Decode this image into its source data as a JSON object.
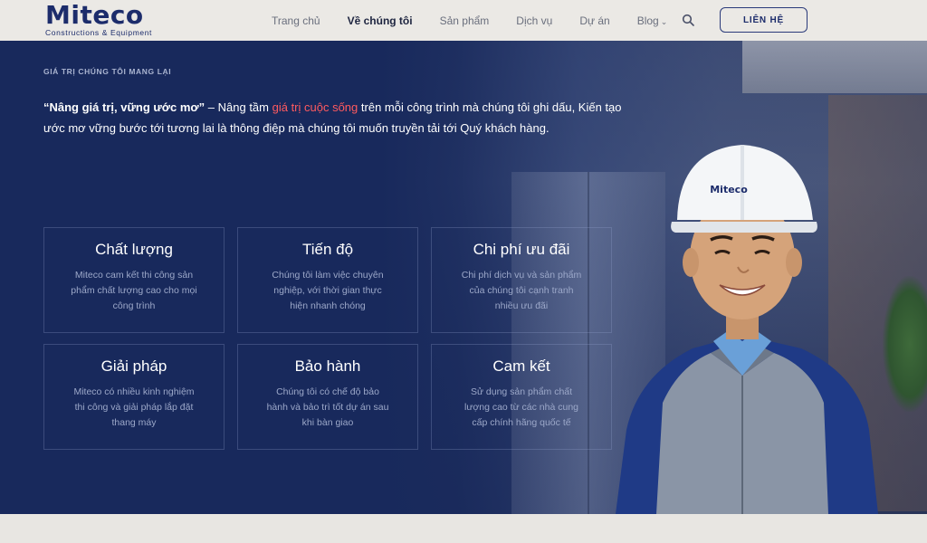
{
  "header": {
    "logo_main": "Miteco",
    "logo_sub": "Constructions & Equipment",
    "nav": [
      {
        "label": "Trang chủ",
        "active": false
      },
      {
        "label": "Về chúng tôi",
        "active": true
      },
      {
        "label": "Sản phẩm",
        "active": false
      },
      {
        "label": "Dịch vụ",
        "active": false
      },
      {
        "label": "Dự án",
        "active": false
      },
      {
        "label": "Blog",
        "active": false
      }
    ],
    "contact_label": "LIÊN HỆ",
    "search_icon": "search-icon"
  },
  "hero": {
    "section_label": "GIÁ TRỊ CHÚNG TÔI MANG LẠI",
    "intro_bold": "“Nâng giá trị, vững ước mơ”",
    "intro_part1": " – Nâng tầm ",
    "intro_highlight": "giá trị cuộc sống",
    "intro_part2": " trên mỗi công trình mà chúng tôi ghi dấu, Kiến tạo ước mơ vững bước tới tương lai là thông điệp mà chúng tôi muốn truyền tải tới Quý khách hàng.",
    "helmet_text": "Miteco",
    "cards": [
      {
        "title": "Chất lượng",
        "desc": "Miteco cam kết thi công sản phẩm chất lượng cao cho mọi công trình"
      },
      {
        "title": "Tiến độ",
        "desc": "Chúng tôi làm việc chuyên nghiệp, với thời gian thực hiện nhanh chóng"
      },
      {
        "title": "Chi phí ưu đãi",
        "desc": "Chi phí dịch vụ và sản phẩm của chúng tôi cạnh tranh nhiều ưu đãi"
      },
      {
        "title": "Giải pháp",
        "desc": "Miteco có nhiều kinh nghiệm thi công và giải pháp lắp đặt thang máy"
      },
      {
        "title": "Bảo hành",
        "desc": "Chúng tôi có chế độ bảo hành và bảo trì tốt dự án sau khi bàn giao"
      },
      {
        "title": "Cam kết",
        "desc": "Sử dụng sản phẩm chất lượng cao từ các nhà cung cấp chính hãng quốc tế"
      }
    ]
  },
  "colors": {
    "brand": "#1c2c6b",
    "hero_bg": "#18295c",
    "highlight": "#ff5a5f"
  }
}
